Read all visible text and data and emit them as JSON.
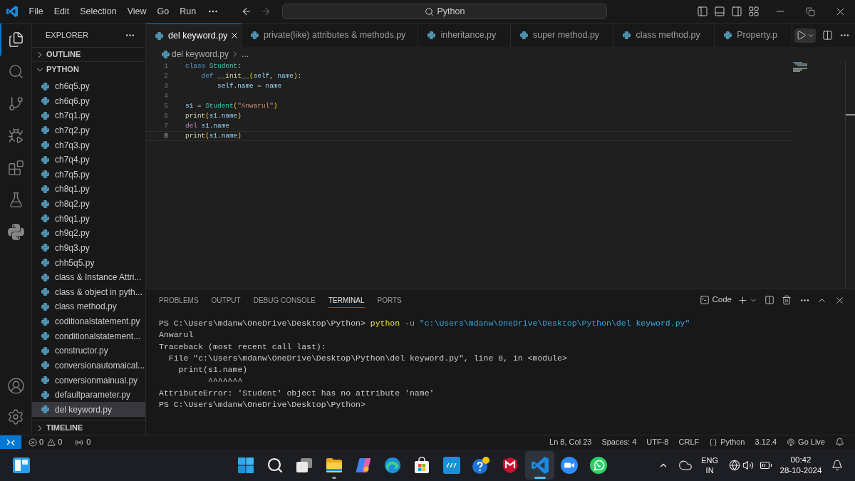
{
  "title_bar": {
    "menu": [
      "File",
      "Edit",
      "Selection",
      "View",
      "Go",
      "Run"
    ],
    "nav": [
      {
        "kind": "back",
        "disabled": false
      },
      {
        "kind": "forward",
        "disabled": true
      }
    ],
    "command_center": "Python"
  },
  "activity_bar": {
    "items": [
      {
        "kind": "explorer",
        "selected": true
      },
      {
        "kind": "search",
        "selected": false
      },
      {
        "kind": "source-control",
        "selected": false
      },
      {
        "kind": "run-debug",
        "selected": false
      },
      {
        "kind": "extensions",
        "selected": false
      },
      {
        "kind": "testing",
        "selected": false
      },
      {
        "kind": "python",
        "selected": false
      }
    ]
  },
  "sidebar": {
    "title": "EXPLORER",
    "sections": [
      {
        "label": "OUTLINE",
        "expanded": false
      },
      {
        "label": "PYTHON",
        "expanded": true,
        "files": [
          {
            "name": "ch6q5.py",
            "selected": false
          },
          {
            "name": "ch6q6.py",
            "selected": false
          },
          {
            "name": "ch7q1.py",
            "selected": false
          },
          {
            "name": "ch7q2.py",
            "selected": false
          },
          {
            "name": "ch7q3.py",
            "selected": false
          },
          {
            "name": "ch7q4.py",
            "selected": false
          },
          {
            "name": "ch7q5.py",
            "selected": false
          },
          {
            "name": "ch8q1.py",
            "selected": false
          },
          {
            "name": "ch8q2.py",
            "selected": false
          },
          {
            "name": "ch9q1.py",
            "selected": false
          },
          {
            "name": "ch9q2.py",
            "selected": false
          },
          {
            "name": "ch9q3.py",
            "selected": false
          },
          {
            "name": "chh5q5.py",
            "selected": false
          },
          {
            "name": "class & Instance Attri...",
            "selected": false
          },
          {
            "name": "class & object in pyth...",
            "selected": false
          },
          {
            "name": "class method.py",
            "selected": false
          },
          {
            "name": "coditionalstatement.py",
            "selected": false
          },
          {
            "name": "conditionalstatement...",
            "selected": false
          },
          {
            "name": "constructor.py",
            "selected": false
          },
          {
            "name": "conversionautomaical...",
            "selected": false
          },
          {
            "name": "conversionmainual.py",
            "selected": false
          },
          {
            "name": "defaultparameter.py",
            "selected": false
          },
          {
            "name": "del keyword.py",
            "selected": true
          }
        ]
      },
      {
        "label": "TIMELINE",
        "expanded": false
      }
    ]
  },
  "editor": {
    "tabs": [
      {
        "label": "del keyword.py",
        "selected": true
      },
      {
        "label": "private(like) attributes & methods.py",
        "selected": false
      },
      {
        "label": "inheritance.py",
        "selected": false
      },
      {
        "label": "super method.py",
        "selected": false
      },
      {
        "label": "class method.py",
        "selected": false
      },
      {
        "label": "Property.p",
        "selected": false
      }
    ],
    "breadcrumb": [
      "del keyword.py",
      "..."
    ],
    "lines": [
      {
        "number": "1",
        "current": false,
        "tokens": [
          {
            "text": "class ",
            "kind": "keyword"
          },
          {
            "text": "Student",
            "kind": "class"
          },
          {
            "text": ":",
            "kind": "plain"
          }
        ]
      },
      {
        "number": "2",
        "current": false,
        "tokens": [
          {
            "text": "    def ",
            "kind": "keyword"
          },
          {
            "text": "__init__",
            "kind": "function"
          },
          {
            "text": "(",
            "kind": "bracket"
          },
          {
            "text": "self",
            "kind": "parameter"
          },
          {
            "text": ", ",
            "kind": "plain"
          },
          {
            "text": "name",
            "kind": "parameter"
          },
          {
            "text": ")",
            "kind": "bracket"
          },
          {
            "text": ":",
            "kind": "plain"
          }
        ]
      },
      {
        "number": "3",
        "current": false,
        "tokens": [
          {
            "text": "        self",
            "kind": "parameter"
          },
          {
            "text": ".",
            "kind": "plain"
          },
          {
            "text": "name",
            "kind": "variable"
          },
          {
            "text": " = ",
            "kind": "plain"
          },
          {
            "text": "name",
            "kind": "parameter"
          }
        ]
      },
      {
        "number": "4",
        "current": false
      },
      {
        "number": "5",
        "current": false,
        "tokens": [
          {
            "text": "s1",
            "kind": "variable"
          },
          {
            "text": " = ",
            "kind": "plain"
          },
          {
            "text": "Student",
            "kind": "class"
          },
          {
            "text": "(",
            "kind": "bracket"
          },
          {
            "text": "\"Anwarul\"",
            "kind": "string"
          },
          {
            "text": ")",
            "kind": "bracket"
          }
        ]
      },
      {
        "number": "6",
        "current": false,
        "tokens": [
          {
            "text": "print",
            "kind": "function"
          },
          {
            "text": "(",
            "kind": "bracket"
          },
          {
            "text": "s1",
            "kind": "variable"
          },
          {
            "text": ".",
            "kind": "plain"
          },
          {
            "text": "name",
            "kind": "variable"
          },
          {
            "text": ")",
            "kind": "bracket"
          }
        ]
      },
      {
        "number": "7",
        "current": false,
        "tokens": [
          {
            "text": "del ",
            "kind": "control"
          },
          {
            "text": "s1",
            "kind": "variable"
          },
          {
            "text": ".",
            "kind": "plain"
          },
          {
            "text": "name",
            "kind": "variable"
          }
        ]
      },
      {
        "number": "8",
        "current": true,
        "tokens": [
          {
            "text": "print",
            "kind": "function"
          },
          {
            "text": "(",
            "kind": "bracket"
          },
          {
            "text": "s1",
            "kind": "variable"
          },
          {
            "text": ".",
            "kind": "plain"
          },
          {
            "text": "name",
            "kind": "variable"
          },
          {
            "text": ")",
            "kind": "bracket"
          }
        ]
      }
    ]
  },
  "panel": {
    "tabs": [
      {
        "label": "PROBLEMS",
        "selected": false
      },
      {
        "label": "OUTPUT",
        "selected": false
      },
      {
        "label": "DEBUG CONSOLE",
        "selected": false
      },
      {
        "label": "TERMINAL",
        "selected": true
      },
      {
        "label": "PORTS",
        "selected": false
      }
    ],
    "terminal_profile": "Code",
    "terminal_lines": [
      {
        "segments": [
          {
            "text": "PS C:\\Users\\mdanw\\OneDrive\\Desktop\\Python> ",
            "kind": "output"
          },
          {
            "text": "python",
            "kind": "command"
          },
          {
            "text": " -u ",
            "kind": "argument"
          },
          {
            "text": "\"c:\\Users\\mdanw\\OneDrive\\Desktop\\Python\\del keyword.py\"",
            "kind": "string"
          }
        ]
      },
      {
        "segments": [
          {
            "text": "Anwarul",
            "kind": "output"
          }
        ]
      },
      {
        "segments": [
          {
            "text": "Traceback (most recent call last):",
            "kind": "output"
          }
        ]
      },
      {
        "segments": [
          {
            "text": "  File \"c:\\Users\\mdanw\\OneDrive\\Desktop\\Python\\del keyword.py\", line 8, in <module>",
            "kind": "output"
          }
        ]
      },
      {
        "segments": [
          {
            "text": "    print(s1.name)",
            "kind": "output"
          }
        ]
      },
      {
        "segments": [
          {
            "text": "          ^^^^^^^",
            "kind": "output"
          }
        ]
      },
      {
        "segments": [
          {
            "text": "AttributeError: 'Student' object has no attribute 'name'",
            "kind": "output"
          }
        ]
      },
      {
        "segments": [
          {
            "text": "PS C:\\Users\\mdanw\\OneDrive\\Desktop\\Python>",
            "kind": "output"
          }
        ]
      }
    ]
  },
  "status_bar": {
    "errors": "0",
    "warnings": "0",
    "ports": "0",
    "items": [
      {
        "kind": "text",
        "label": "Ln 8, Col 23"
      },
      {
        "kind": "text",
        "label": "Spaces: 4"
      },
      {
        "kind": "text",
        "label": "UTF-8"
      },
      {
        "kind": "text",
        "label": "CRLF"
      },
      {
        "kind": "language",
        "label": "Python"
      },
      {
        "kind": "text",
        "label": "3.12.4"
      },
      {
        "kind": "live",
        "label": "Go Live"
      }
    ]
  },
  "taskbar": {
    "apps": [
      {
        "kind": "start",
        "running": false,
        "focused": false
      },
      {
        "kind": "search",
        "running": false,
        "focused": false
      },
      {
        "kind": "task-view",
        "running": false,
        "focused": false
      },
      {
        "kind": "file-explorer",
        "running": true,
        "focused": false
      },
      {
        "kind": "copilot",
        "running": false,
        "focused": false
      },
      {
        "kind": "edge",
        "running": false,
        "focused": false
      },
      {
        "kind": "store",
        "running": false,
        "focused": false
      },
      {
        "kind": "myhp",
        "running": false,
        "focused": false
      },
      {
        "kind": "help",
        "running": false,
        "focused": false
      },
      {
        "kind": "mcafee",
        "running": false,
        "focused": false
      },
      {
        "kind": "vscode",
        "running": true,
        "focused": true
      },
      {
        "kind": "zoom",
        "running": false,
        "focused": false
      },
      {
        "kind": "whatsapp",
        "running": false,
        "focused": false
      }
    ],
    "tray": {
      "language": "ENG",
      "region": "IN",
      "time": "00:42",
      "date": "28-10-2024"
    }
  }
}
